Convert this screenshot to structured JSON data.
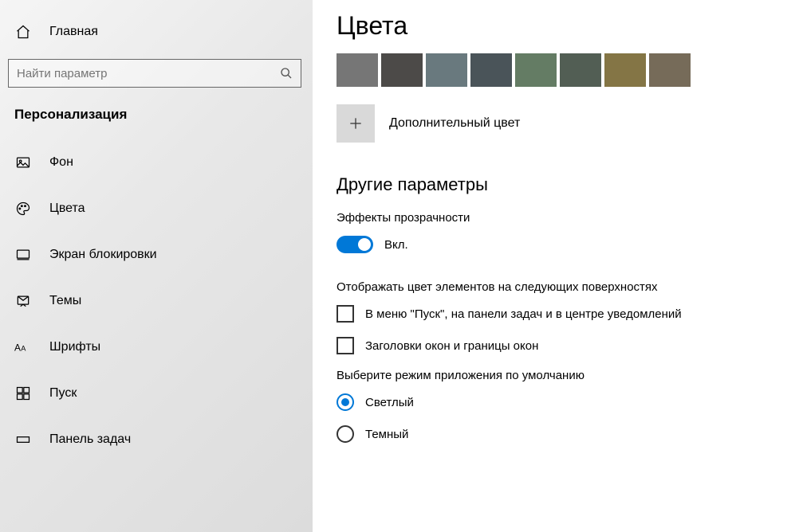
{
  "sidebar": {
    "home_label": "Главная",
    "search_placeholder": "Найти параметр",
    "section_title": "Персонализация",
    "items": [
      {
        "icon": "picture-icon",
        "label": "Фон"
      },
      {
        "icon": "palette-icon",
        "label": "Цвета"
      },
      {
        "icon": "lockscreen-icon",
        "label": "Экран блокировки"
      },
      {
        "icon": "themes-icon",
        "label": "Темы"
      },
      {
        "icon": "fonts-icon",
        "label": "Шрифты"
      },
      {
        "icon": "start-icon",
        "label": "Пуск"
      },
      {
        "icon": "taskbar-icon",
        "label": "Панель задач"
      }
    ]
  },
  "main": {
    "title": "Цвета",
    "swatches": [
      "#767676",
      "#4c4a48",
      "#69797e",
      "#4a5459",
      "#647c64",
      "#525e54",
      "#847545",
      "#766b59"
    ],
    "add_color_label": "Дополнительный цвет",
    "other_heading": "Другие параметры",
    "transparency": {
      "label": "Эффекты прозрачности",
      "state": "Вкл."
    },
    "surfaces": {
      "label": "Отображать цвет элементов на следующих поверхностях",
      "options": [
        "В меню \"Пуск\", на панели задач и в центре уведомлений",
        "Заголовки окон и границы окон"
      ]
    },
    "app_mode": {
      "label": "Выберите режим приложения по умолчанию",
      "options": [
        {
          "label": "Светлый",
          "selected": true
        },
        {
          "label": "Темный",
          "selected": false
        }
      ]
    }
  }
}
